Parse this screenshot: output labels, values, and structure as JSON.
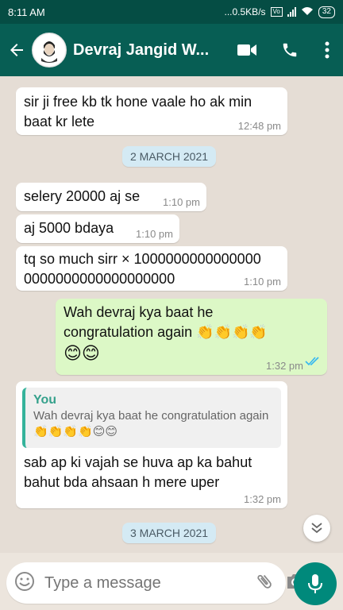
{
  "status_bar": {
    "time": "8:11 AM",
    "network_speed": "0.5KB/s",
    "network_type": "VoLTE",
    "battery": "32"
  },
  "header": {
    "contact_name": "Devraj Jangid W...",
    "avatar_icon": "man-with-beard-avatar",
    "icons": [
      "back-arrow-icon",
      "video-call-icon",
      "phone-icon",
      "more-vert-icon"
    ]
  },
  "messages": [
    {
      "dir": "in",
      "text_lines": [
        "sir ji free kb tk hone vaale ho ak min",
        "baat kr lete"
      ],
      "time": "12:48 pm"
    },
    {
      "dir": "in",
      "text_lines": [
        "selery 20000 aj se"
      ],
      "time": "1:10 pm"
    },
    {
      "dir": "in",
      "text_lines": [
        "aj 5000 bdaya"
      ],
      "time": "1:10 pm"
    },
    {
      "dir": "in",
      "text_lines": [
        "tq so much sirr × 1000000000000000",
        "0000000000000000000"
      ],
      "time": "1:10 pm"
    },
    {
      "dir": "out",
      "text_lines": [
        "Wah devraj kya baat he",
        "congratulation again 👏👏👏👏",
        "😊😊"
      ],
      "time": "1:32 pm",
      "status": "read"
    },
    {
      "dir": "in",
      "quote": {
        "author": "You",
        "text": "Wah devraj kya baat he congratulation again 👏👏👏👏😊😊"
      },
      "text_lines": [
        "sab ap ki vajah se huva  ap ka bahut",
        "bahut bda ahsaan h mere uper"
      ],
      "time": "1:32 pm"
    }
  ],
  "dates": [
    "2 MARCH 2021",
    "3 MARCH 2021"
  ],
  "input": {
    "placeholder": "Type a message"
  },
  "colors": {
    "header": "#075e54",
    "status_bar": "#054d44",
    "outgoing_bubble": "#dcf8c6",
    "incoming_bubble": "#ffffff",
    "mic_button": "#00897b",
    "read_ticks": "#34b7f1"
  }
}
